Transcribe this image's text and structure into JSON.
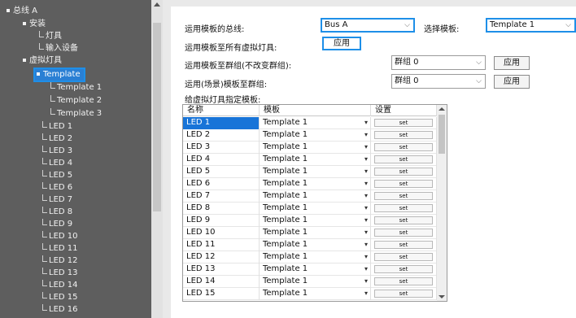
{
  "tree": {
    "items": [
      {
        "label": "总线 A"
      },
      {
        "label": "安装"
      },
      {
        "label": "灯具"
      },
      {
        "label": "输入设备"
      },
      {
        "label": "虚拟灯具"
      },
      {
        "label": "Template"
      },
      {
        "label": "Template 1"
      },
      {
        "label": "Template 2"
      },
      {
        "label": "Template 3"
      },
      {
        "label": "LED 1"
      },
      {
        "label": "LED 2"
      },
      {
        "label": "LED 3"
      },
      {
        "label": "LED 4"
      },
      {
        "label": "LED 5"
      },
      {
        "label": "LED 6"
      },
      {
        "label": "LED 7"
      },
      {
        "label": "LED 8"
      },
      {
        "label": "LED 9"
      },
      {
        "label": "LED 10"
      },
      {
        "label": "LED 11"
      },
      {
        "label": "LED 12"
      },
      {
        "label": "LED 13"
      },
      {
        "label": "LED 14"
      },
      {
        "label": "LED 15"
      },
      {
        "label": "LED 16"
      }
    ]
  },
  "form": {
    "bus_label": "运用模板的总线:",
    "bus_value": "Bus A",
    "template_label": "选择模板:",
    "template_value": "Template 1",
    "apply_all_label": "运用模板至所有虚拟灯具:",
    "apply_button": "应用",
    "group_keep_label": "运用模板至群组(不改变群组):",
    "group_keep_value": "群组 0",
    "group_keep_button": "应用",
    "group_scene_label": "运用(场景)模板至群组:",
    "group_scene_value": "群组 0",
    "group_scene_button": "应用",
    "assign_label": "给虚拟灯具指定模板:"
  },
  "grid": {
    "headers": [
      "名称",
      "模板",
      "设置"
    ],
    "set_label": "set",
    "rows": [
      {
        "name": "LED 1",
        "template": "Template 1"
      },
      {
        "name": "LED 2",
        "template": "Template 1"
      },
      {
        "name": "LED 3",
        "template": "Template 1"
      },
      {
        "name": "LED 4",
        "template": "Template 1"
      },
      {
        "name": "LED 5",
        "template": "Template 1"
      },
      {
        "name": "LED 6",
        "template": "Template 1"
      },
      {
        "name": "LED 7",
        "template": "Template 1"
      },
      {
        "name": "LED 8",
        "template": "Template 1"
      },
      {
        "name": "LED 9",
        "template": "Template 1"
      },
      {
        "name": "LED 10",
        "template": "Template 1"
      },
      {
        "name": "LED 11",
        "template": "Template 1"
      },
      {
        "name": "LED 12",
        "template": "Template 1"
      },
      {
        "name": "LED 13",
        "template": "Template 1"
      },
      {
        "name": "LED 14",
        "template": "Template 1"
      },
      {
        "name": "LED 15",
        "template": "Template 1"
      }
    ]
  }
}
